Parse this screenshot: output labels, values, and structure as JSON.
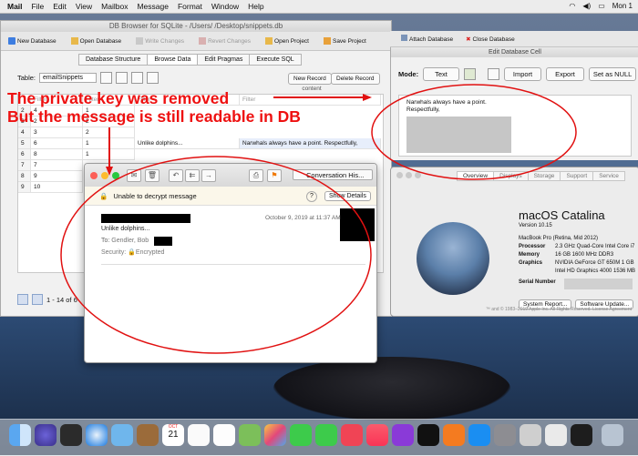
{
  "menubar": {
    "app_name": "Mail",
    "items": [
      "File",
      "Edit",
      "View",
      "Mailbox",
      "Message",
      "Format",
      "Window",
      "Help"
    ],
    "clock": "Mon 1"
  },
  "db_window": {
    "title": "DB Browser for SQLite - /Users/        /Desktop/snippets.db",
    "toolbar": [
      "New Database",
      "Open Database",
      "Write Changes",
      "Revert Changes",
      "Open Project",
      "Save Project",
      "Attach Database",
      "Close Database"
    ],
    "tabs": [
      "Database Structure",
      "Browse Data",
      "Edit Pragmas",
      "Execute SQL"
    ],
    "table_label": "Table:",
    "table_value": "emailSnippets",
    "new_record": "New Record",
    "delete_record": "Delete Record",
    "content_header": "content",
    "filter_label": "Filter",
    "row_numbers": [
      "2",
      "3",
      "4",
      "5",
      "6",
      "7",
      "8",
      "9"
    ],
    "id_values": [
      "4",
      "2",
      "3",
      "6",
      "8",
      "7",
      "9",
      "10"
    ],
    "col2_values": [
      "1",
      "2",
      "2",
      "1",
      "1"
    ],
    "snippet_col2": "Unlike dolphins...",
    "snippet_content": "Narwhals always have a point. Respectfully,",
    "pager": "1 - 14 of 6"
  },
  "edit_cell": {
    "title": "Edit Database Cell",
    "mode_label": "Mode:",
    "mode_value": "Text",
    "import": "Import",
    "export": "Export",
    "set_null": "Set as NULL",
    "line1": "Narwhals always have a point.",
    "line2": "Respectfully,"
  },
  "about_mac": {
    "tabs": [
      "Overview",
      "Displays",
      "Storage",
      "Support",
      "Service"
    ],
    "os_name": "macOS Catalina",
    "version": "Version 10.15",
    "model": "MacBook Pro (Retina, Mid 2012)",
    "processor_label": "Processor",
    "processor": "2.3 GHz Quad-Core Intel Core i7",
    "memory_label": "Memory",
    "memory": "16 GB 1600 MHz DDR3",
    "graphics_label": "Graphics",
    "graphics": "NVIDIA GeForce GT 650M 1 GB",
    "graphics2": "Intel HD Graphics 4000 1536 MB",
    "serial_label": "Serial Number",
    "system_report": "System Report...",
    "software_update": "Software Update...",
    "footer": "™ and © 1983–2019 Apple Inc. All Rights Reserved. License Agreement"
  },
  "mail": {
    "convo_label": "Conversation His...",
    "banner_text": "Unable to decrypt message",
    "show_details": "Show Details",
    "subject": "Unlike dolphins...",
    "to_label": "To:",
    "to_value": "Gendler, Bob",
    "security_label": "Security:",
    "security_value": "Encrypted",
    "date": "October 9, 2019 at 11:37 AM"
  },
  "annotations": {
    "line1": "The private key was removed",
    "line2": "But the message is still readable in DB",
    "color": "#e11111"
  },
  "dock": {
    "calendar_month": "OCT",
    "calendar_day": "21"
  }
}
